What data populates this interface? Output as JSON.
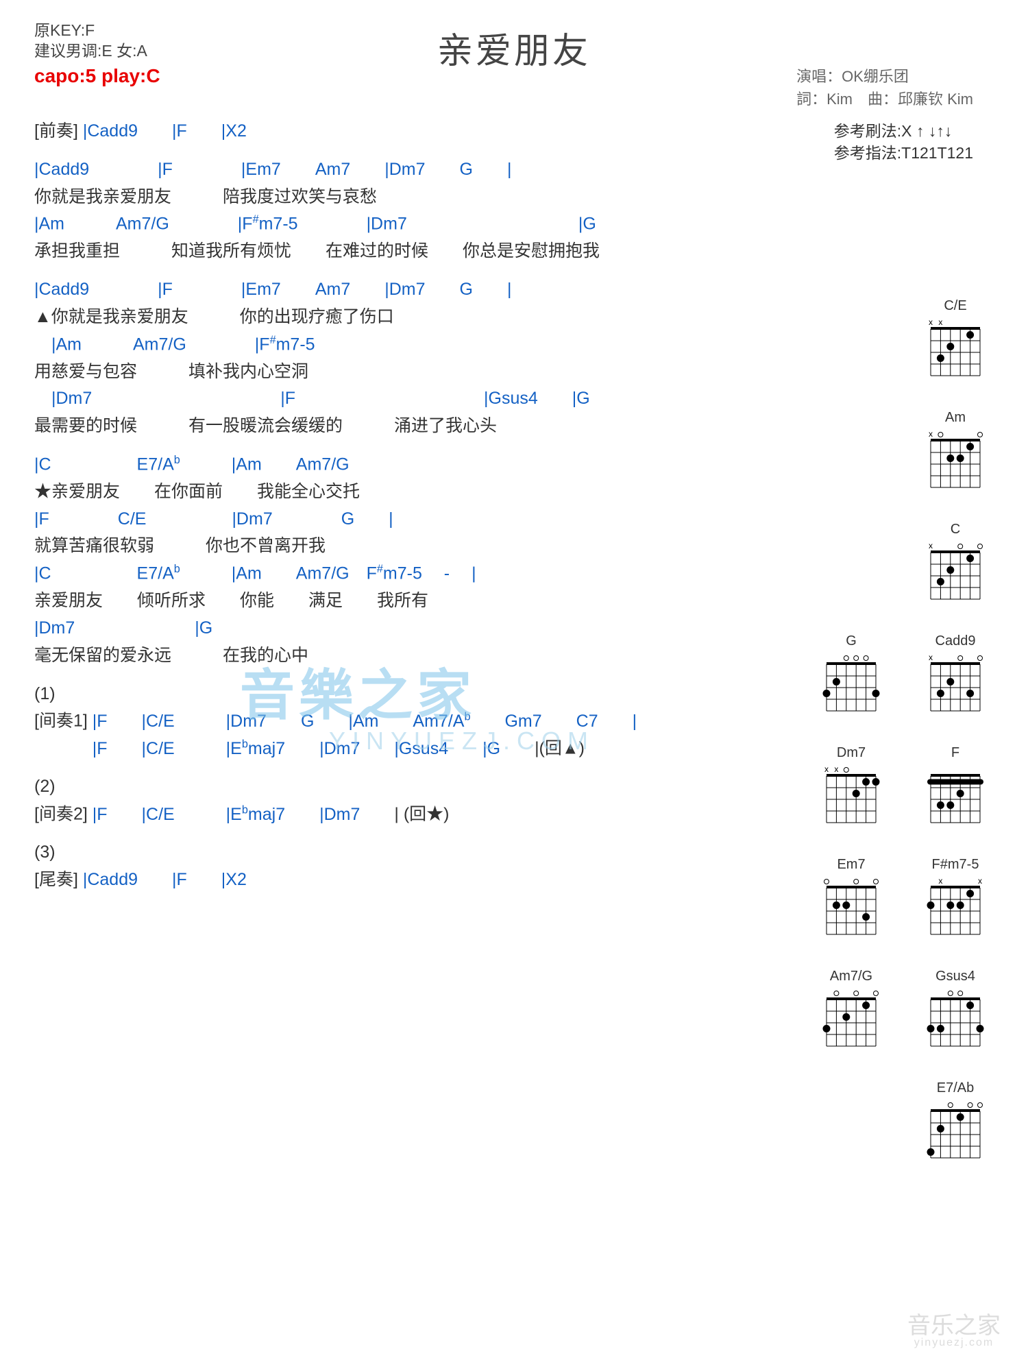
{
  "title": "亲爱朋友",
  "key_info_l1": "原KEY:F",
  "key_info_l2": "建议男调:E 女:A",
  "capo": "capo:5 play:C",
  "credits_l1": "演唱：OK绷乐团",
  "credits_l2": "詞：Kim　曲：邱廉钦 Kim",
  "ref_l1": "参考刷法:X ↑ ↓↑↓",
  "ref_l2": "参考指法:T121T121",
  "intro_label": "[前奏]",
  "intro_chords": "|Cadd9　　|F　　|X2",
  "v1c1": "|Cadd9　　　　|F　　　　|Em7　　Am7　　|Dm7　　G　　|",
  "v1l1": "你就是我亲爱朋友　　　陪我度过欢笑与哀愁",
  "v1c2": "|Am　　　Am7/G　　　　|F#m7-5　　　　|Dm7　　　　　　　　　|G",
  "v1l2": "承担我重担　　　知道我所有烦忧　　在难过的时候　　你总是安慰拥抱我",
  "v2c1": "|Cadd9　　　　|F　　　　|Em7　　Am7　　|Dm7　　G　　|",
  "v2l1": "▲你就是我亲爱朋友　　　你的出现疗癒了伤口",
  "v2c2": "　|Am　　　Am7/G　　　　|F#m7-5",
  "v2l2": "用慈爱与包容　　　填补我内心空洞",
  "v2c3": "　|Dm7　　　　　　　　　　　|F　　　　　　　　　　　|Gsus4　　|G",
  "v2l3": "最需要的时候　　　有一股暖流会缓缓的　　　涌进了我心头",
  "c1c1": "|C　　　　　E7/Ab　　　|Am　　Am7/G",
  "c1l1": "★亲爱朋友　　在你面前　　我能全心交托",
  "c1c2": "|F　　　　C/E　　　　　|Dm7　　　　G　　|",
  "c1l2": "就算苦痛很软弱　　　你也不曾离开我",
  "c1c3": "|C　　　　　E7/Ab　　　|Am　　Am7/G　F#m7-5　 -　 |",
  "c1l3": "亲爱朋友　　倾听所求　　你能　　满足　　我所有",
  "c1c4": "|Dm7　　　　　　　|G",
  "c1l4": "毫无保留的爱永远　　　在我的心中",
  "p1": "(1)",
  "i1lbl": "[间奏1]",
  "i1l1": "|F　　|C/E　　　|Dm7　　G　　|Am　　Am7/Ab　　Gm7　　C7　　|",
  "i1l2": "|F　　|C/E　　　|Ebmaj7　　|Dm7　　|Gsus4　　|G　　|(回▲)",
  "p2": "(2)",
  "i2lbl": "[间奏2]",
  "i2": "|F　　|C/E　　　|Ebmaj7　　|Dm7　　| (回★)",
  "p3": "(3)",
  "outlbl": "[尾奏]",
  "out": "|Cadd9　　|F　　|X2",
  "wm_main": "音樂之家",
  "wm_sub": "YINYUEZJ.COM",
  "corner_main": "音乐之家",
  "corner_sub": "yinyuezj.com",
  "diagrams": [
    [
      "C/E"
    ],
    [
      "Am"
    ],
    [
      "C"
    ],
    [
      "G",
      "Cadd9"
    ],
    [
      "Dm7",
      "F"
    ],
    [
      "Em7",
      "F#m7-5"
    ],
    [
      "Am7/G",
      "Gsus4"
    ],
    [
      "E7/Ab"
    ]
  ]
}
